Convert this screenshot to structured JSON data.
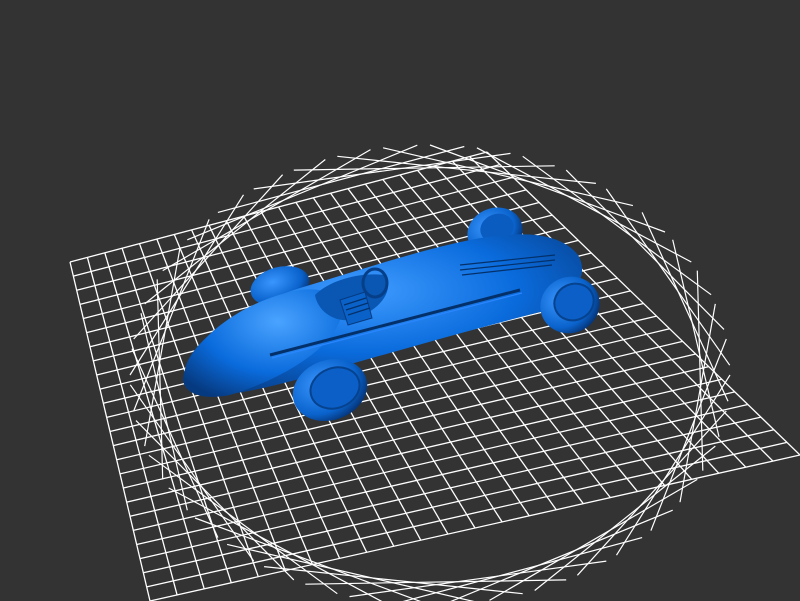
{
  "viewport": {
    "background_color": "#333333",
    "grid_color": "#ffffff",
    "model_color": "#0a6bdc",
    "model_highlight": "#2e8cff",
    "model_shadow": "#0a3f8f",
    "grid_visible": true,
    "model_icon": "race-car-icon"
  }
}
